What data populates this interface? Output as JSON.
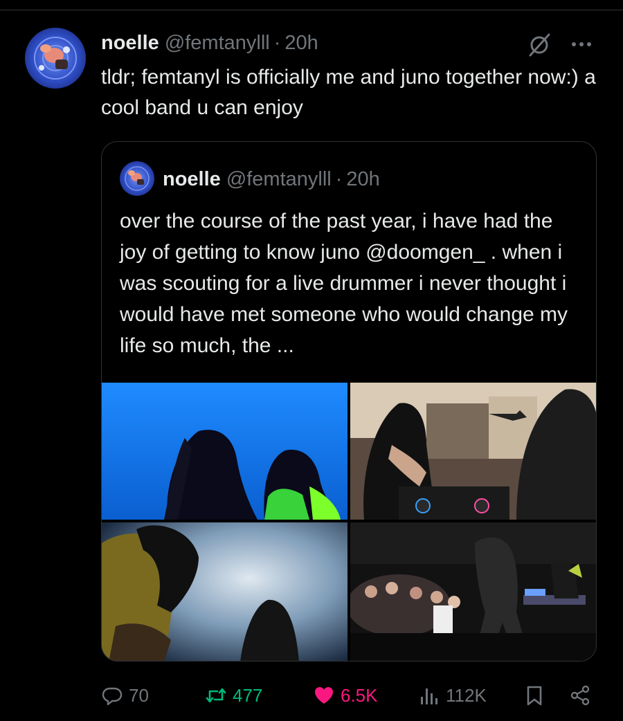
{
  "tweet": {
    "display_name": "noelle",
    "handle": "@femtanylll",
    "separator": "·",
    "time": "20h",
    "text": "tldr; femtanyl is officially me and juno together now:) a cool band u can enjoy",
    "avatar_icon": "user-avatar"
  },
  "quote": {
    "display_name": "noelle",
    "handle": "@femtanylll",
    "separator": "·",
    "time": "20h",
    "text": "over the course of the past year, i have had the joy of getting to know juno @doomgen_ . when i was scouting for a live drummer i never thought i would have met someone who would change my life so much, the ...",
    "media": [
      {
        "kind": "photo",
        "scene": "two performers silhouetted against blue light"
      },
      {
        "kind": "photo",
        "scene": "performer at DJ controller in a room"
      },
      {
        "kind": "photo",
        "scene": "performers in hazy stage light"
      },
      {
        "kind": "photo",
        "scene": "performer on stage facing crowd"
      }
    ]
  },
  "actions": {
    "replies": "70",
    "reposts": "477",
    "likes": "6.5K",
    "views": "112K",
    "reply_icon": "reply-icon",
    "repost_icon": "repost-icon",
    "like_icon": "heart-icon",
    "views_icon": "views-icon",
    "bookmark_icon": "bookmark-icon",
    "share_icon": "share-icon"
  },
  "colors": {
    "background": "#000000",
    "text": "#e7e9ea",
    "muted": "#71767b",
    "border": "#2f3336",
    "repost": "#00ba7c",
    "like": "#f91880"
  }
}
